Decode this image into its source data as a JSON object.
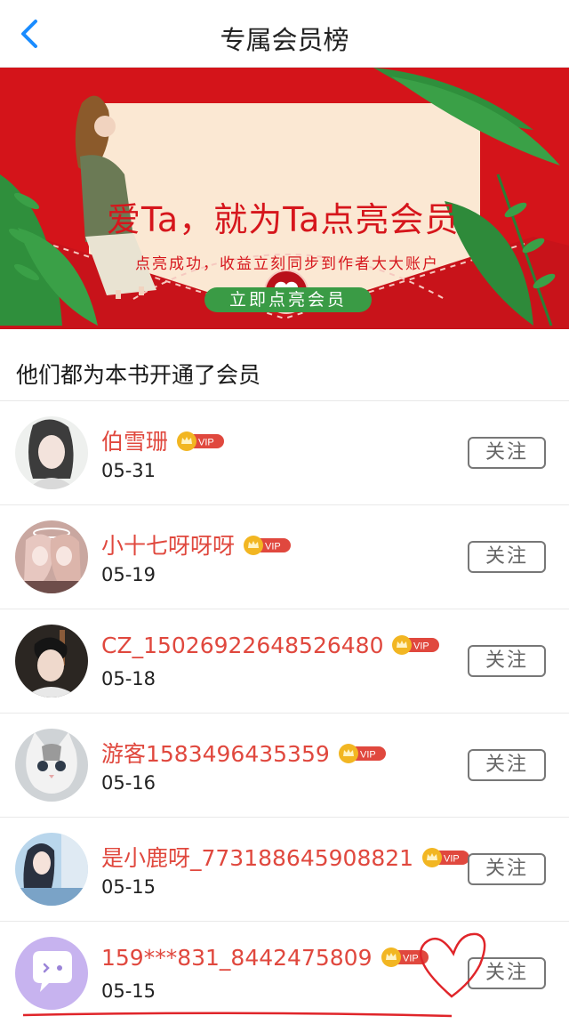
{
  "header": {
    "title": "专属会员榜"
  },
  "banner": {
    "headline": "爱Ta，就为Ta点亮会员",
    "subtitle": "点亮成功，收益立刻同步到作者大大账户",
    "cta_label": "立即点亮会员"
  },
  "section": {
    "title": "他们都为本书开通了会员"
  },
  "members": [
    {
      "name": "伯雪珊",
      "date": "05-31",
      "vip": "VIP",
      "follow_label": "关注"
    },
    {
      "name": "小十七呀呀呀",
      "date": "05-19",
      "vip": "VIP",
      "follow_label": "关注"
    },
    {
      "name": "CZ_15026922648526480",
      "date": "05-18",
      "vip": "VIP",
      "follow_label": "关注"
    },
    {
      "name": "游客1583496435359",
      "date": "05-16",
      "vip": "VIP",
      "follow_label": "关注"
    },
    {
      "name": "是小鹿呀_773188645908821",
      "date": "05-15",
      "vip": "VIP",
      "follow_label": "关注"
    },
    {
      "name": "159***831_8442475809",
      "date": "05-15",
      "vip": "VIP",
      "follow_label": "关注"
    }
  ],
  "colors": {
    "accent_blue": "#1a8cff",
    "name_red": "#e0483e",
    "banner_red": "#d4141a",
    "cta_green": "#3a9b45",
    "vip_gold": "#f2b622"
  }
}
